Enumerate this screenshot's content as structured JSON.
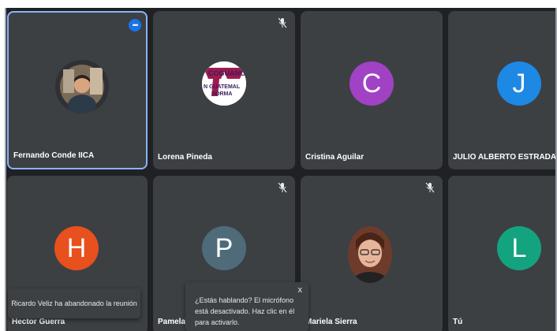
{
  "colors": {
    "stage_bg": "#202124",
    "tile_bg": "#3c4043",
    "active_border": "#8ab4f8",
    "accent": "#1a73e8"
  },
  "participants": [
    {
      "name": "Fernando Conde IICA",
      "avatar": "photo",
      "icon": "more-options-icon"
    },
    {
      "name": "Lorena Pineda",
      "avatar": "logo",
      "logo_text": [
        "COGUANO",
        "N GUATEMAL",
        "NORMA"
      ],
      "icon": "mic-off-icon"
    },
    {
      "name": "Cristina Aguilar",
      "initial": "C",
      "color": "#a142c4"
    },
    {
      "name": "JULIO ALBERTO ESTRADA MORALES",
      "initial": "J",
      "color": "#1e88e5"
    },
    {
      "name": "Hector Guerra",
      "initial": "H",
      "color": "#e8501e"
    },
    {
      "name": "Pamela C",
      "initial": "P",
      "color": "#4f6b7a",
      "icon": "mic-off-icon"
    },
    {
      "name": "Mariela Sierra",
      "avatar": "photo",
      "icon": "mic-off-icon"
    },
    {
      "name": "Tú",
      "initial": "L",
      "color": "#14a37f"
    }
  ],
  "toasts": {
    "left_message": "Ricardo Veliz ha abandonado la reunión",
    "mic_message": "¿Estás hablando? El micrófono está desactivado. Haz clic en él para activarlo.",
    "close_label": "x"
  }
}
